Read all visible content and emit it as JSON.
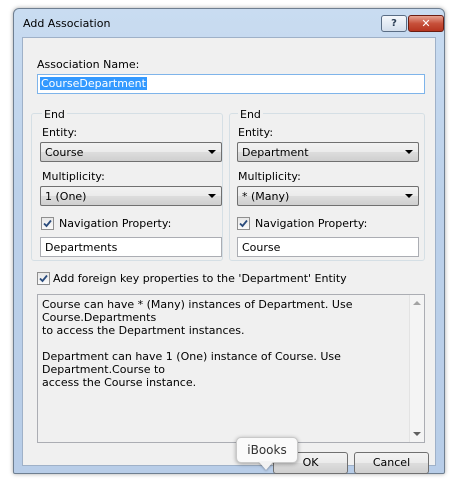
{
  "window": {
    "title": "Add Association",
    "help_label": "?",
    "close_label": "✕"
  },
  "association_name": {
    "label": "Association Name:",
    "value": "CourseDepartment"
  },
  "end1": {
    "group_label": "End",
    "entity_label": "Entity:",
    "entity_value": "Course",
    "multiplicity_label": "Multiplicity:",
    "multiplicity_value": "1 (One)",
    "nav_checked": true,
    "nav_label": "Navigation Property:",
    "nav_value": "Departments"
  },
  "end2": {
    "group_label": "End",
    "entity_label": "Entity:",
    "entity_value": "Department",
    "multiplicity_label": "Multiplicity:",
    "multiplicity_value": "* (Many)",
    "nav_checked": true,
    "nav_label": "Navigation Property:",
    "nav_value": "Course"
  },
  "foreign_key": {
    "checked": true,
    "label": "Add foreign key properties to the 'Department' Entity"
  },
  "description": "Course can have * (Many) instances of Department. Use Course.Departments\nto access the Department instances.\n\nDepartment can have 1 (One) instance of Course. Use Department.Course to\naccess the Course instance.",
  "buttons": {
    "ok_label": "OK",
    "cancel_label": "Cancel"
  },
  "tooltip": {
    "label": "iBooks"
  },
  "colors": {
    "accent": "#3399ff",
    "close_button": "#c7503a",
    "titlebar": "#c9dcf1"
  }
}
